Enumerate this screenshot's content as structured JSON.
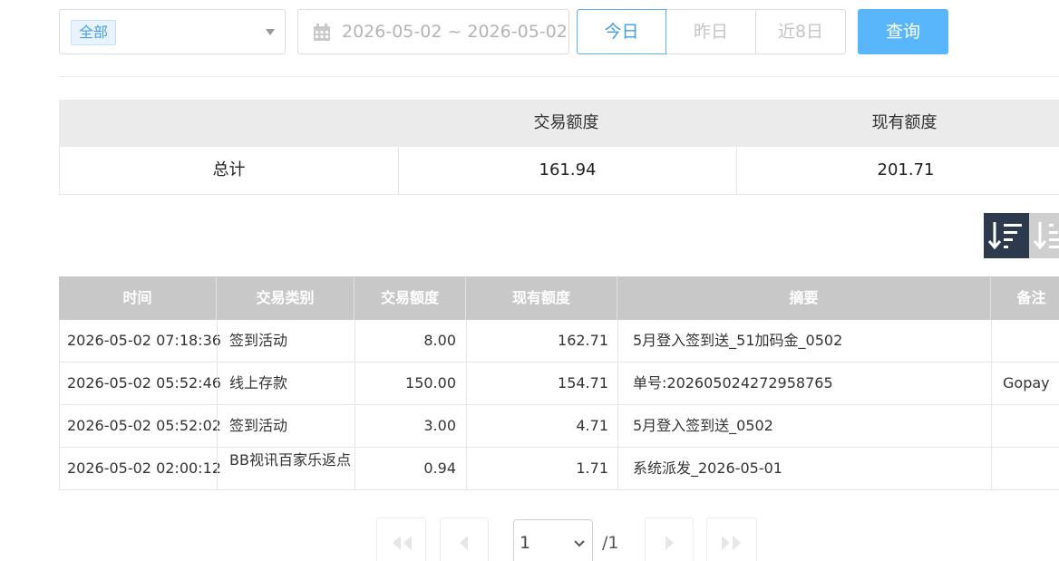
{
  "filters": {
    "category_selected": "全部",
    "date_range": "2026-05-02 ~ 2026-05-02",
    "quick_today": "今日",
    "quick_yesterday": "昨日",
    "quick_last8": "近8日",
    "query_button": "查询"
  },
  "summary": {
    "headers": [
      "",
      "交易额度",
      "现有额度"
    ],
    "row_label": "总计",
    "trade_amount": "161.94",
    "current_amount": "201.71"
  },
  "detail": {
    "headers": [
      "时间",
      "交易类别",
      "交易额度",
      "现有额度",
      "摘要",
      "备注"
    ],
    "rows": [
      {
        "time": "2026-05-02 07:18:36",
        "type": "签到活动",
        "amount": "8.00",
        "balance": "162.71",
        "summary": "5月登入签到送_51加码金_0502",
        "note": ""
      },
      {
        "time": "2026-05-02 05:52:46",
        "type": "线上存款",
        "amount": "150.00",
        "balance": "154.71",
        "summary": "单号:202605024272958765",
        "note": "Gopay"
      },
      {
        "time": "2026-05-02 05:52:02",
        "type": "签到活动",
        "amount": "3.00",
        "balance": "4.71",
        "summary": "5月登入签到送_0502",
        "note": ""
      },
      {
        "time": "2026-05-02 02:00:12",
        "type": "BB视讯百家乐返点",
        "amount": "0.94",
        "balance": "1.71",
        "summary": "系统派发_2026-05-01",
        "note": ""
      }
    ]
  },
  "pagination": {
    "current_page": "1",
    "total_pages": "/1"
  },
  "colors": {
    "primary": "#5ab6fa",
    "accent_text": "#3d9ce9",
    "sort_active": "#2d3a4d",
    "header_gray": "#c8c8c8"
  },
  "icons": [
    "chevron-down-icon",
    "calendar-icon",
    "sort-desc-icon",
    "sort-asc-icon",
    "first-page-icon",
    "prev-page-icon",
    "next-page-icon",
    "last-page-icon"
  ]
}
